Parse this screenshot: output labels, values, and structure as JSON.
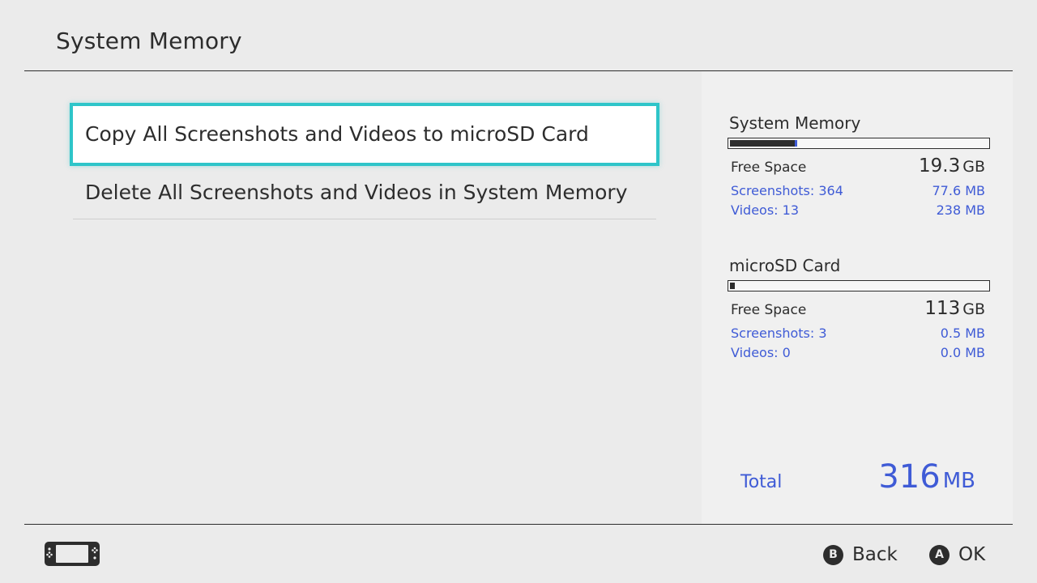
{
  "header": {
    "title": "System Memory"
  },
  "menu": {
    "items": [
      {
        "label": "Copy All Screenshots and Videos to microSD Card",
        "selected": true
      },
      {
        "label": "Delete All Screenshots and Videos in System Memory",
        "selected": false
      }
    ]
  },
  "storage": {
    "system": {
      "name": "System Memory",
      "usage_fraction": 0.25,
      "free_label": "Free Space",
      "free_value": "19.3",
      "free_unit": "GB",
      "screenshots_label": "Screenshots: 364",
      "screenshots_size": "77.6 MB",
      "videos_label": "Videos: 13",
      "videos_size": "238 MB"
    },
    "microsd": {
      "name": "microSD Card",
      "usage_fraction": 0.02,
      "free_label": "Free Space",
      "free_value": "113",
      "free_unit": "GB",
      "screenshots_label": "Screenshots: 3",
      "screenshots_size": "0.5 MB",
      "videos_label": "Videos: 0",
      "videos_size": "0.0 MB"
    }
  },
  "total": {
    "label": "Total",
    "value": "316",
    "unit": "MB"
  },
  "footer": {
    "back_glyph": "B",
    "back_label": "Back",
    "ok_glyph": "A",
    "ok_label": "OK",
    "console_icon": "handheld-console-icon"
  },
  "colors": {
    "background": "#ebebeb",
    "panel": "#f0f0f0",
    "text": "#2d2d2d",
    "accent_blue": "#3f5bd6",
    "selection_cyan": "#2ec5c9"
  }
}
